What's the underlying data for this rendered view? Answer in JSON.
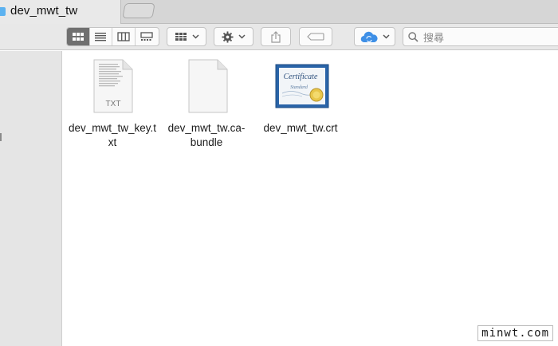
{
  "window": {
    "tab_title": "dev_mwt_tw",
    "search_placeholder": "搜尋"
  },
  "icons": {
    "tab_folder": "folder-icon",
    "view_icons": "icon-view-icon",
    "view_list": "list-view-icon",
    "view_columns": "column-view-icon",
    "view_cover_flow": "cover-flow-view-icon",
    "arrange": "arrange-grid-icon",
    "action": "gear-icon",
    "share": "share-icon",
    "tags": "tag-icon",
    "icloud": "icloud-icon",
    "search": "search-icon"
  },
  "files": [
    {
      "name": "dev_mwt_tw_key.t\nxt",
      "label_line1": "dev_mwt_tw_key.t",
      "label_line2": "xt",
      "icon": "txt-file-icon",
      "badge": "TXT"
    },
    {
      "name": "dev_mwt_tw.ca-bundle",
      "label_line1": "dev_mwt_tw.ca-",
      "label_line2": "bundle",
      "icon": "blank-document-icon"
    },
    {
      "name": "dev_mwt_tw.crt",
      "label_line1": "dev_mwt_tw.crt",
      "label_line2": "",
      "icon": "certificate-icon",
      "cert_title": "Certificate",
      "cert_sub": "Standard"
    }
  ],
  "watermark": "minwt.com",
  "colors": {
    "accent_blue": "#5cb2f0",
    "icloud_blue": "#3e8fe6",
    "active_segment": "#6f6f6f"
  }
}
